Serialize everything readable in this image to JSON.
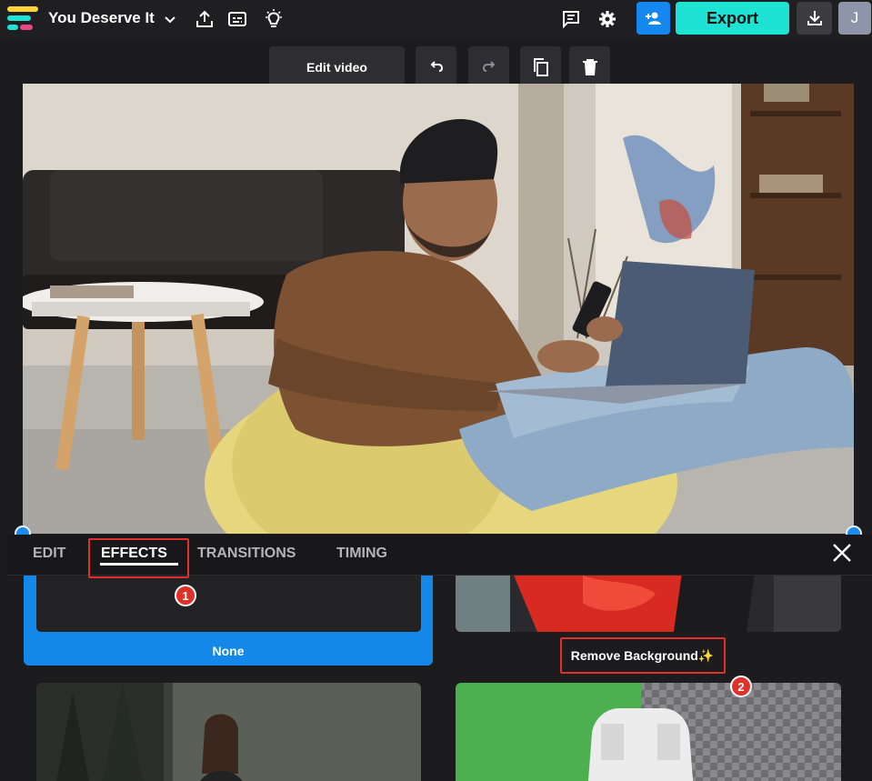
{
  "topbar": {
    "project_title": "You Deserve It",
    "export_label": "Export",
    "avatar_initial": "J",
    "logo_colors": [
      "#ffd43b",
      "#1ee3d4",
      "#e64980"
    ]
  },
  "canvas_toolbar": {
    "edit_video_label": "Edit video"
  },
  "panel": {
    "tabs": [
      {
        "label": "EDIT",
        "active": false
      },
      {
        "label": "EFFECTS",
        "active": true
      },
      {
        "label": "TRANSITIONS",
        "active": false
      },
      {
        "label": "TIMING",
        "active": false
      }
    ]
  },
  "effects": {
    "none_label": "None",
    "remove_bg_label": "Remove Background✨"
  },
  "annotations": {
    "step_1": "1",
    "step_2": "2"
  },
  "colors": {
    "accent_blue": "#1488e8",
    "export_teal": "#1ee3d4",
    "annotation_red": "#e0302a"
  }
}
